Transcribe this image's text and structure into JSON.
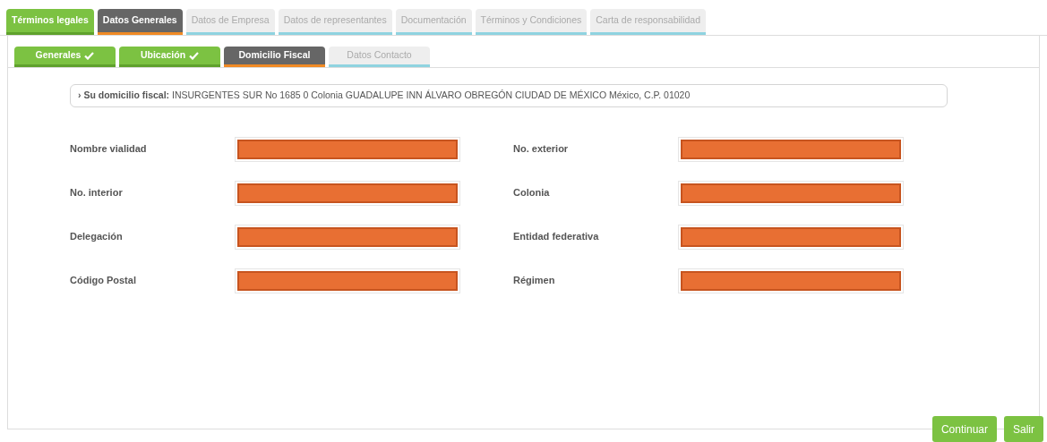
{
  "main_tabs": [
    {
      "label": "Términos legales",
      "completed": true,
      "selected": false
    },
    {
      "label": "Datos Generales",
      "completed": false,
      "selected": true
    },
    {
      "label": "Datos de Empresa",
      "completed": false,
      "selected": false
    },
    {
      "label": "Datos de representantes",
      "completed": false,
      "selected": false
    },
    {
      "label": "Documentación",
      "completed": false,
      "selected": false
    },
    {
      "label": "Términos y Condiciones",
      "completed": false,
      "selected": false
    },
    {
      "label": "Carta de responsabilidad",
      "completed": false,
      "selected": false
    }
  ],
  "sub_tabs": [
    {
      "label": "Generales",
      "completed": true,
      "selected": false
    },
    {
      "label": "Ubicación",
      "completed": true,
      "selected": false
    },
    {
      "label": "Domicilio Fiscal",
      "completed": false,
      "selected": true
    },
    {
      "label": "Datos Contacto",
      "completed": false,
      "selected": false
    }
  ],
  "address": {
    "prefix": "›",
    "label": "Su domicilio fiscal:",
    "value": "INSURGENTES SUR No 1685 0 Colonia GUADALUPE INN ÁLVARO OBREGÓN CIUDAD DE MÉXICO México, C.P. 01020"
  },
  "fields": [
    {
      "label": "Nombre vialidad",
      "redacted": true
    },
    {
      "label": "No. exterior",
      "redacted": true
    },
    {
      "label": "No. interior",
      "redacted": true
    },
    {
      "label": "Colonia",
      "redacted": true
    },
    {
      "label": "Delegación",
      "redacted": true
    },
    {
      "label": "Entidad federativa",
      "redacted": true
    },
    {
      "label": "Código Postal",
      "redacted": true
    },
    {
      "label": "Régimen",
      "redacted": true
    }
  ],
  "buttons": [
    "Continuar",
    "Salir"
  ]
}
